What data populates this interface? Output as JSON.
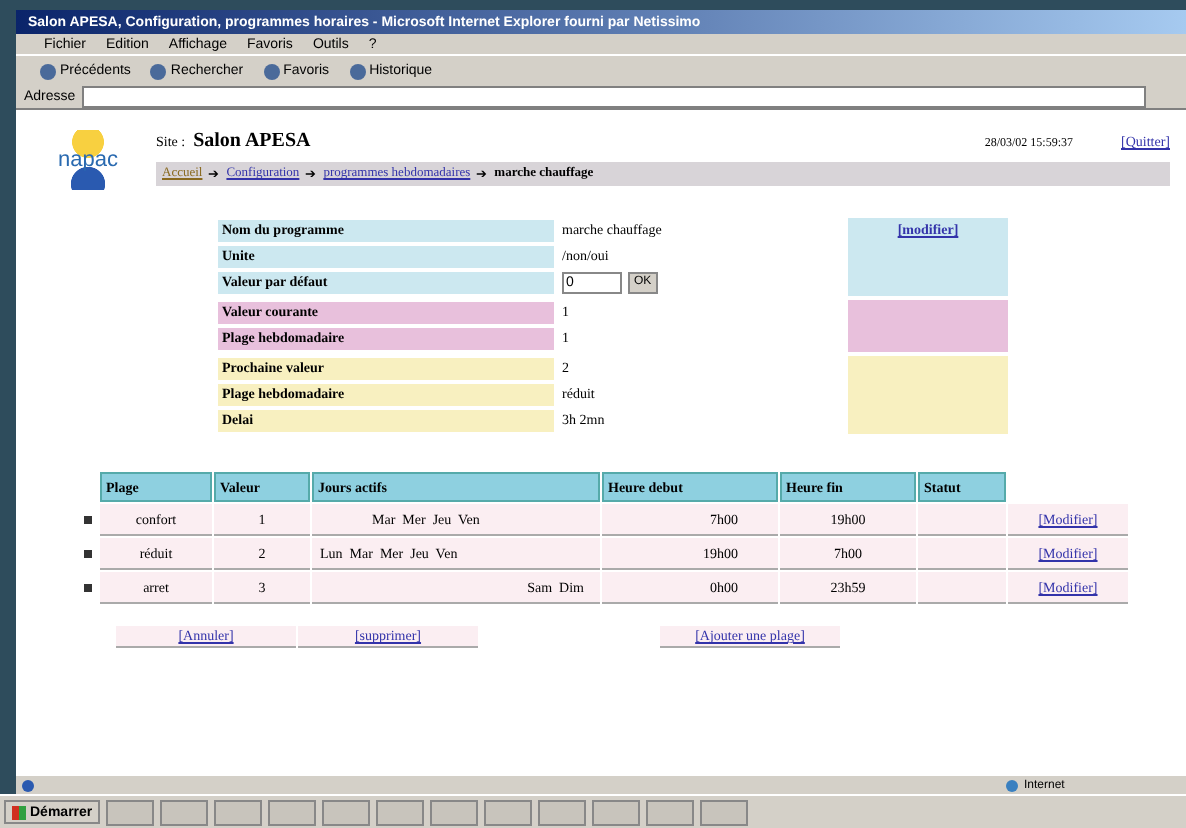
{
  "window": {
    "title": "Salon APESA, Configuration, programmes horaires - Microsoft Internet Explorer fourni par Netissimo"
  },
  "menu": [
    "Fichier",
    "Edition",
    "Affichage",
    "Favoris",
    "Outils",
    "?"
  ],
  "toolbar": [
    "Précédents",
    "Rechercher",
    "Favoris",
    "Historique"
  ],
  "address": {
    "label": "Adresse"
  },
  "page": {
    "logo": "napac",
    "site_label": "Site :",
    "site_name": "Salon APESA",
    "datetime": "28/03/02 15:59:37",
    "quit": "[Quitter]",
    "breadcrumb": [
      {
        "label": "Accueil",
        "kind": "link"
      },
      {
        "label": "➔",
        "kind": "sep"
      },
      {
        "label": "Configuration",
        "kind": "link"
      },
      {
        "label": "➔",
        "kind": "sep"
      },
      {
        "label": "programmes hebdomadaires",
        "kind": "link"
      },
      {
        "label": "➔",
        "kind": "sep"
      },
      {
        "label": "marche chauffage",
        "kind": "current"
      }
    ],
    "groups": [
      {
        "color": "#cce8f0",
        "action": "[modifier]",
        "rows": [
          {
            "label": "Nom du programme",
            "value": "marche chauffage",
            "kind": "text"
          },
          {
            "label": "Unite",
            "value": "/non/oui",
            "kind": "text"
          },
          {
            "label": "Valeur par défaut",
            "value": "0",
            "button": "OK",
            "kind": "input"
          }
        ]
      },
      {
        "color": "#e8c0dc",
        "rows": [
          {
            "label": "Valeur courante",
            "value": "1",
            "kind": "text"
          },
          {
            "label": "Plage hebdomadaire",
            "value": "1",
            "kind": "text"
          }
        ]
      },
      {
        "color": "#f8f0c0",
        "rows": [
          {
            "label": "Prochaine valeur",
            "value": "2",
            "kind": "text"
          },
          {
            "label": "Plage hebdomadaire",
            "value": "réduit",
            "kind": "text"
          },
          {
            "label": "Delai",
            "value": "3h  2mn",
            "kind": "text"
          }
        ]
      }
    ]
  },
  "table": {
    "columns": [
      "Plage",
      "Valeur",
      "Jours actifs",
      "Heure debut",
      "Heure fin",
      "Statut"
    ],
    "rows": [
      {
        "plage": "confort",
        "valeur": "1",
        "jours": "Mar  Mer  Jeu  Ven",
        "debut": "7h00",
        "fin": "19h00",
        "action": "[Modifier]"
      },
      {
        "plage": "réduit",
        "valeur": "2",
        "jours": "Lun  Mar  Mer  Jeu  Ven",
        "debut": "19h00",
        "fin": "7h00",
        "action": "[Modifier]"
      },
      {
        "plage": "arret",
        "valeur": "3",
        "jours": "Sam  Dim",
        "debut": "0h00",
        "fin": "23h59",
        "action": "[Modifier]"
      }
    ]
  },
  "actions": [
    "[Annuler]",
    "[supprimer]",
    "[Ajouter une plage]"
  ],
  "status_bar": {
    "zone": "Internet"
  },
  "taskbar": {
    "start": "Démarrer"
  }
}
